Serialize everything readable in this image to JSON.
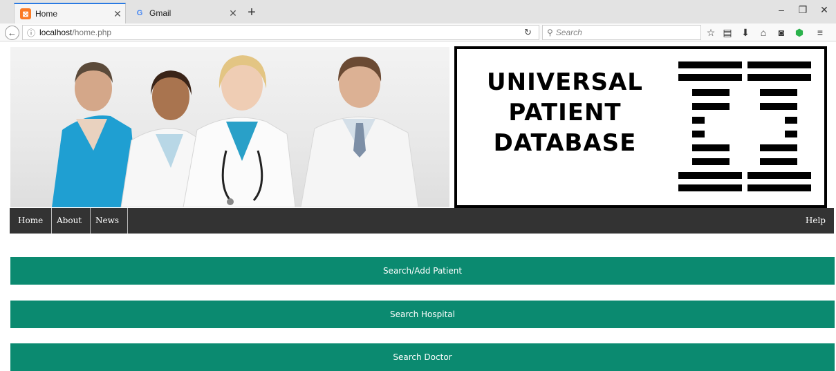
{
  "browser": {
    "tabs": [
      {
        "label": "Home",
        "favicon": "xampp-icon",
        "active": true
      },
      {
        "label": "Gmail",
        "favicon": "gmail-icon",
        "active": false
      }
    ],
    "url_host": "localhost",
    "url_path": "/home.php",
    "search_placeholder": "Search",
    "favicon_glyphs": {
      "xampp": "⊠",
      "gmail": "G"
    }
  },
  "banner": {
    "logo_lines": [
      "UNIVERSAL",
      "PATIENT",
      "DATABASE"
    ]
  },
  "nav": {
    "items": [
      "Home",
      "About",
      "News"
    ],
    "right_item": "Help"
  },
  "actions": {
    "search_add_patient": "Search/Add Patient",
    "search_hospital": "Search Hospital",
    "search_doctor": "Search Doctor"
  },
  "colors": {
    "accent": "#0b8a70",
    "nav_bg": "#333333"
  }
}
